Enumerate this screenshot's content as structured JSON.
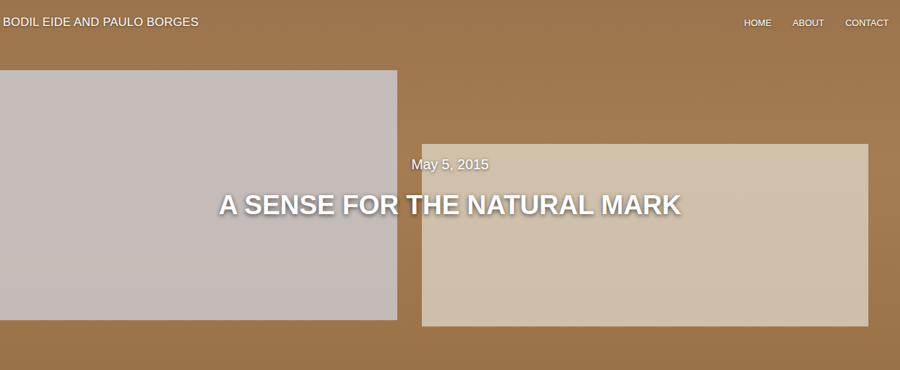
{
  "site": {
    "title": "BODIL EIDE AND PAULO BORGES"
  },
  "nav": [
    {
      "label": "HOME"
    },
    {
      "label": "ABOUT"
    },
    {
      "label": "CONTACT"
    }
  ],
  "post": {
    "date": "May 5, 2015",
    "title": "A SENSE FOR THE NATURAL MARK"
  }
}
